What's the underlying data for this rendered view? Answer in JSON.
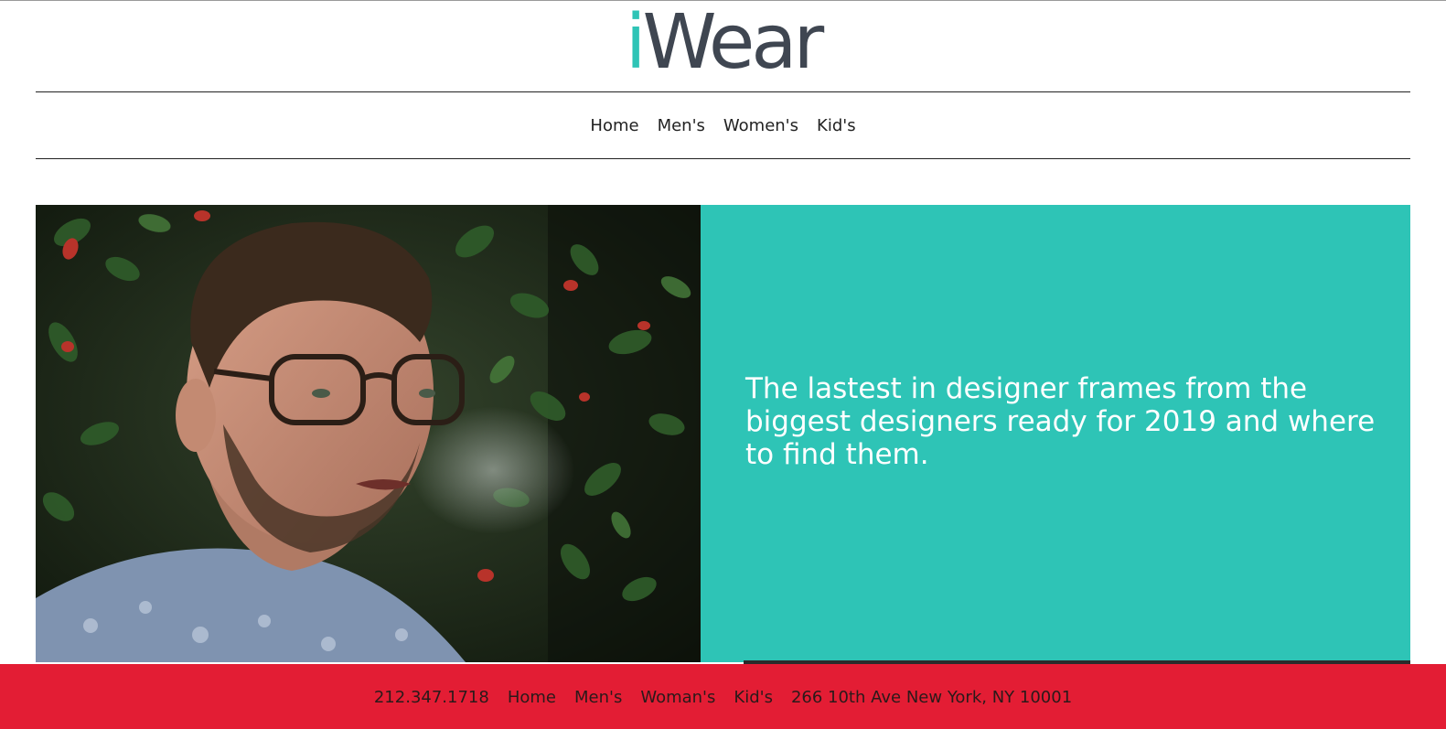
{
  "brand": {
    "logo_i": "i",
    "logo_rest": "Wear",
    "accent_color": "#2ec4b6",
    "text_color": "#3f4651"
  },
  "nav": {
    "items": [
      "Home",
      "Men's",
      "Women's",
      "Kid's"
    ]
  },
  "hero": {
    "headline": "The lastest in designer frames from the biggest designers ready for 2019 and where to find them.",
    "panel_color": "#2ec4b6",
    "image_subject": "man-with-glasses-photo"
  },
  "footer": {
    "phone": "212.347.1718",
    "links": [
      "Home",
      "Men's",
      "Woman's",
      "Kid's"
    ],
    "address": "266 10th Ave New York, NY 10001",
    "background_color": "#e31d34"
  }
}
